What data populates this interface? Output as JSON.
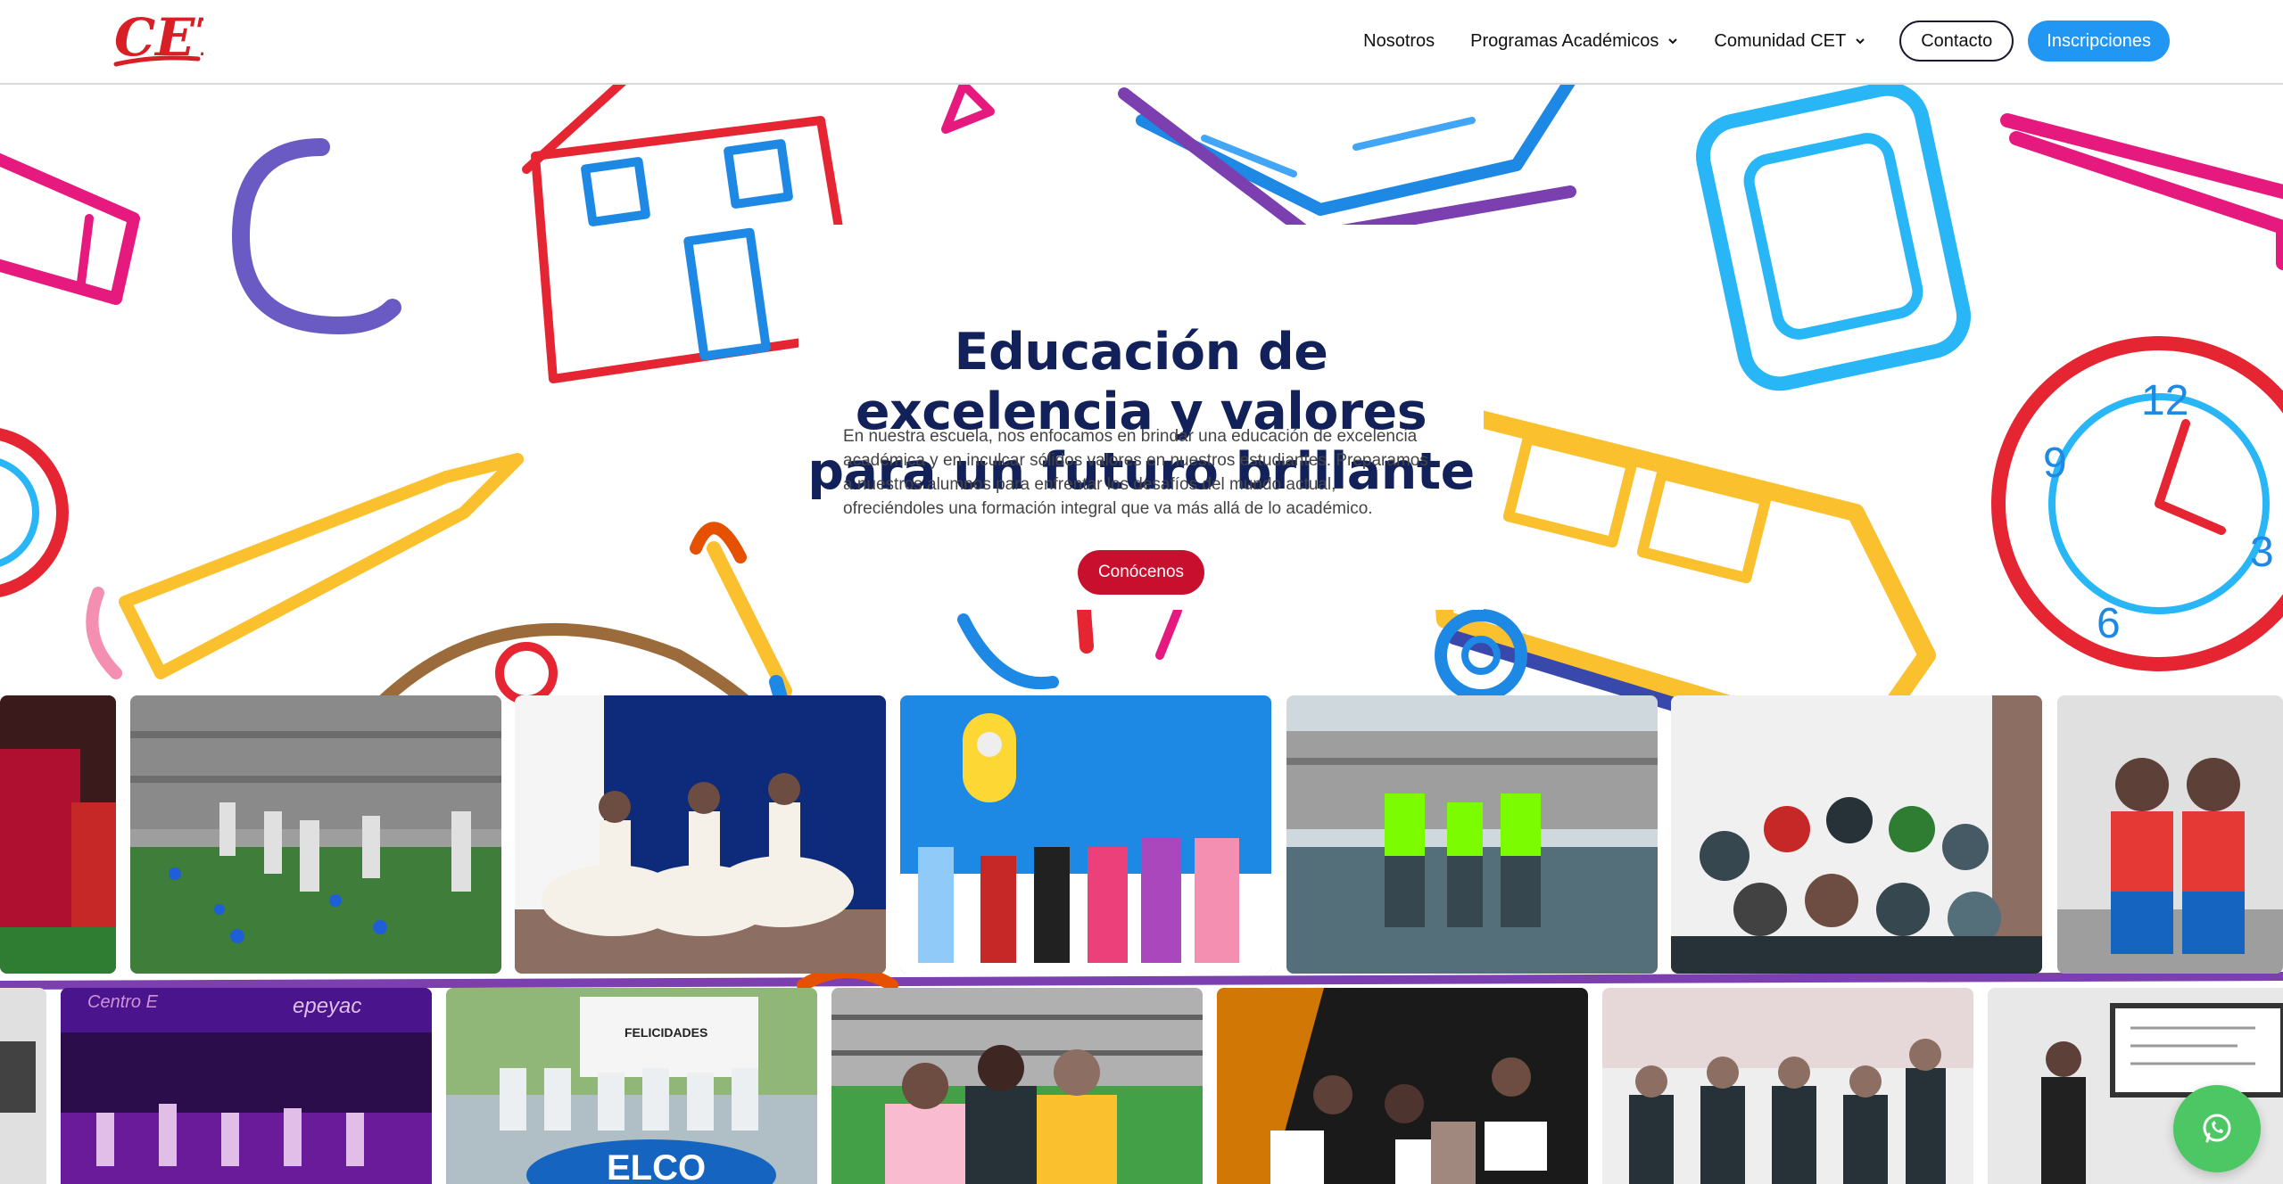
{
  "brand": {
    "logo_text": "CET",
    "logo_color": "#d81f26"
  },
  "nav": {
    "items": [
      {
        "label": "Nosotros",
        "dropdown": false
      },
      {
        "label": "Programas Académicos",
        "dropdown": true
      },
      {
        "label": "Comunidad CET",
        "dropdown": true
      }
    ],
    "contact_label": "Contacto",
    "enroll_label": "Inscripciones"
  },
  "hero": {
    "title_line1": "Educación de",
    "title_line2": "excelencia y valores",
    "title_line3": "para un futuro brillante",
    "description": "En nuestra escuela, nos enfocamos en brindar una educación de excelencia académica y en inculcar sólidos valores en nuestros estudiantes. Preparamos a nuestros alumnos para enfrentar los desafíos del mundo actual, ofreciéndoles una formación integral que va más allá de lo académico.",
    "cta_label": "Conócenos"
  },
  "gallery": {
    "row1": [
      "party-photo",
      "students-playground-photo",
      "ballet-dancers-photo",
      "costume-kids-photo",
      "green-shirts-photo",
      "class-group-photo",
      "two-girls-photo"
    ],
    "row2": [
      "classroom-edge-photo",
      "stage-performance-photo",
      "felicidades-team-photo",
      "friends-campus-photo",
      "award-ceremony-photo",
      "classroom-suits-photo",
      "teacher-screen-photo"
    ]
  },
  "colors": {
    "title": "#13215a",
    "cta": "#c8102e",
    "enroll": "#2196f3",
    "whatsapp": "#4cc764"
  },
  "icons": {
    "whatsapp": "whatsapp-icon",
    "chevron": "chevron-down-icon"
  }
}
